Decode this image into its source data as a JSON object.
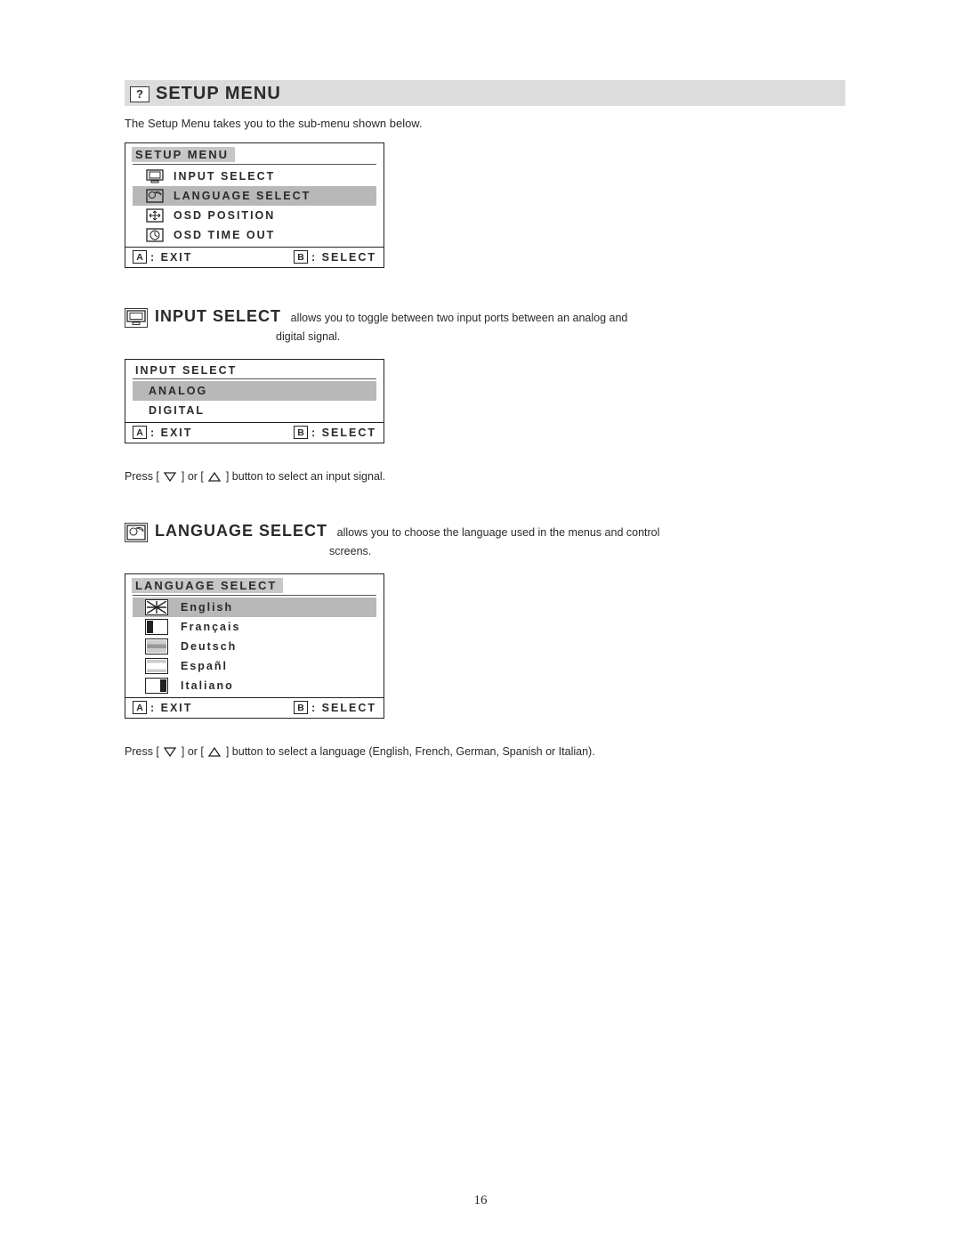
{
  "header": {
    "icon_glyph": "?",
    "title": "SETUP MENU"
  },
  "intro": "The Setup Menu takes you to the sub-menu shown below.",
  "setup_menu": {
    "title": "SETUP MENU",
    "items": [
      {
        "label": "INPUT SELECT",
        "highlighted": false
      },
      {
        "label": "LANGUAGE SELECT",
        "highlighted": true
      },
      {
        "label": "OSD POSITION",
        "highlighted": false
      },
      {
        "label": "OSD TIME OUT",
        "highlighted": false
      }
    ],
    "footer": {
      "a_key": "A",
      "a_label": ": EXIT",
      "b_key": "B",
      "b_label": ": SELECT"
    }
  },
  "input_section": {
    "title": "INPUT SELECT",
    "desc_line1": "allows you to toggle between two input ports between an analog and",
    "desc_line2": "digital signal.",
    "menu": {
      "title": "INPUT SELECT",
      "items": [
        {
          "label": "ANALOG",
          "highlighted": true
        },
        {
          "label": "DIGITAL",
          "highlighted": false
        }
      ],
      "footer": {
        "a_key": "A",
        "a_label": ": EXIT",
        "b_key": "B",
        "b_label": ": SELECT"
      }
    },
    "instruction_pre": "Press [",
    "instruction_mid": "] or [",
    "instruction_post": "] button to select an input signal."
  },
  "language_section": {
    "title": "LANGUAGE SELECT",
    "desc_line1": "allows you to choose the language used in the menus and control",
    "desc_line2": "screens.",
    "menu": {
      "title": "LANGUAGE SELECT",
      "items": [
        {
          "label": "English",
          "highlighted": true
        },
        {
          "label": "Français",
          "highlighted": false
        },
        {
          "label": "Deutsch",
          "highlighted": false
        },
        {
          "label": "Españl",
          "highlighted": false
        },
        {
          "label": "Italiano",
          "highlighted": false
        }
      ],
      "footer": {
        "a_key": "A",
        "a_label": ": EXIT",
        "b_key": "B",
        "b_label": ": SELECT"
      }
    },
    "instruction_pre": "Press [",
    "instruction_mid": "] or [",
    "instruction_post": "] button to select a language (English, French, German, Spanish or Italian)."
  },
  "page_number": "16"
}
